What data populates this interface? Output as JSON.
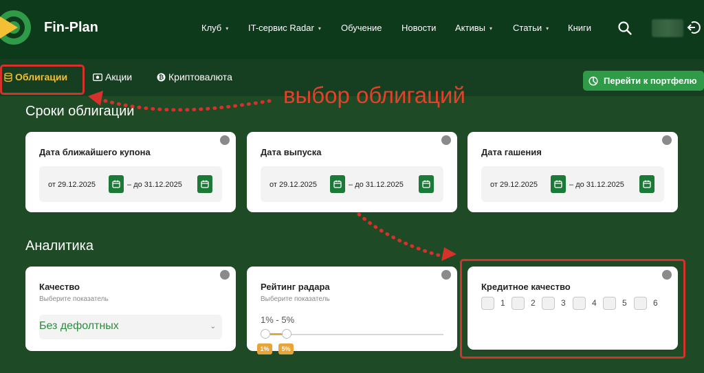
{
  "header": {
    "brand": "Fin-Plan",
    "nav": [
      {
        "label": "Клуб",
        "dropdown": true
      },
      {
        "label": "IT-сервис Radar",
        "dropdown": true
      },
      {
        "label": "Обучение",
        "dropdown": false
      },
      {
        "label": "Новости",
        "dropdown": false
      },
      {
        "label": "Активы",
        "dropdown": true
      },
      {
        "label": "Статьи",
        "dropdown": true
      },
      {
        "label": "Книги",
        "dropdown": false
      }
    ]
  },
  "tabs": [
    {
      "label": "Облигации",
      "active": true,
      "icon": "database-icon"
    },
    {
      "label": "Акции",
      "active": false,
      "icon": "banknote-icon"
    },
    {
      "label": "Криптовалюта",
      "active": false,
      "icon": "bitcoin-icon"
    }
  ],
  "portfolio_button": "Перейти к портфелю",
  "annotation": "выбор облигаций",
  "sections": {
    "terms": "Сроки облигации",
    "analytics": "Аналитика"
  },
  "date_cards": [
    {
      "title": "Дата ближайшего купона",
      "from_prefix": "от",
      "from": "29.12.2025",
      "to_prefix": "до",
      "to": "31.12.2025"
    },
    {
      "title": "Дата выпуска",
      "from_prefix": "от",
      "from": "29.12.2025",
      "to_prefix": "до",
      "to": "31.12.2025"
    },
    {
      "title": "Дата гашения",
      "from_prefix": "от",
      "from": "29.12.2025",
      "to_prefix": "до",
      "to": "31.12.2025"
    }
  ],
  "quality_card": {
    "title": "Качество",
    "subtitle": "Выберите показатель",
    "value": "Без дефолтных"
  },
  "rating_card": {
    "title": "Рейтинг радара",
    "subtitle": "Выберите показатель",
    "range_text": "1% - 5%",
    "min_label": "1%",
    "max_label": "5%",
    "min": 1,
    "max": 5
  },
  "credit_card": {
    "title": "Кредитное качество",
    "options": [
      "1",
      "2",
      "3",
      "4",
      "5",
      "6"
    ]
  },
  "colors": {
    "accent_green": "#2f9a48",
    "active_tab": "#f3c035",
    "highlight_red": "#d6322c"
  }
}
